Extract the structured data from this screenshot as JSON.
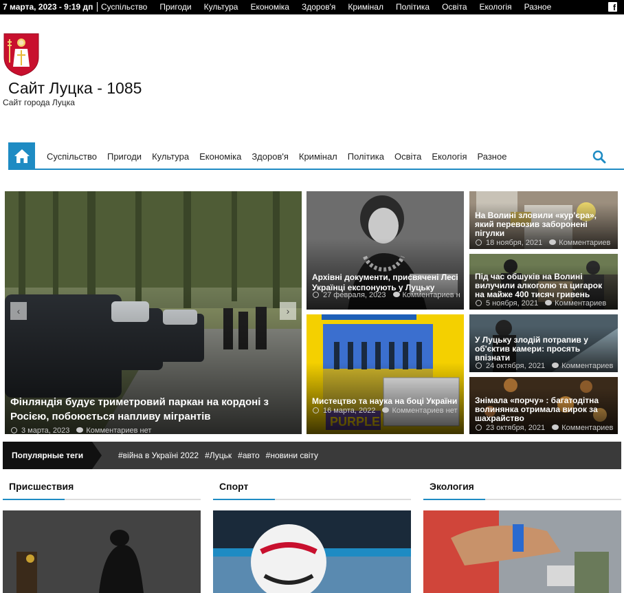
{
  "topbar": {
    "date": "7 марта, 2023 - 9:19 дп",
    "nav": [
      "Суспільство",
      "Пригоди",
      "Культура",
      "Економіка",
      "Здоров'я",
      "Кримінал",
      "Політика",
      "Освіта",
      "Екологія",
      "Разное"
    ],
    "social_icon": "facebook-icon"
  },
  "header": {
    "title": "Сайт Луцка - 1085",
    "tagline": "Сайт города Луцка"
  },
  "mainnav": {
    "items": [
      "Суспільство",
      "Пригоди",
      "Культура",
      "Економіка",
      "Здоров'я",
      "Кримінал",
      "Політика",
      "Освіта",
      "Екологія",
      "Разное"
    ],
    "home_icon": "home-icon",
    "search_icon": "search-icon"
  },
  "featured": {
    "big": {
      "title": "Фінляндія будує триметровий паркан на кордоні з Росією, побоюється напливу мігрантів",
      "date": "3 марта, 2023",
      "comments": "Комментариев нет"
    },
    "mid": [
      {
        "title": "Архівні документи, присвячені Лесі Українці експонують у Луцьку",
        "date": "27 февраля, 2023",
        "comments": "Комментариев нет"
      },
      {
        "title": "Мистецтво та наука на боці України",
        "date": "16 марта, 2022",
        "comments": "Комментариев нет"
      }
    ],
    "small": [
      {
        "title": "На Волині зловили «кур'єра», який перевозив заборонені пігулки",
        "date": "18 ноября, 2021",
        "comments": "Комментариев"
      },
      {
        "title": "Під час обшуків на Волині вилучили алкоголю та цигарок на майже 400 тисяч гривень",
        "date": "5 ноября, 2021",
        "comments": "Комментариев"
      },
      {
        "title": "У Луцьку злодій потрапив у об'єктив камери: просять впізнати",
        "date": "24 октября, 2021",
        "comments": "Комментариев"
      },
      {
        "title": "Знімала «порчу» : багатодітна волинянка отримала вирок за шахрайство",
        "date": "23 октября, 2021",
        "comments": "Комментариев"
      }
    ]
  },
  "tags": {
    "label": "Популярные теги",
    "items": [
      "#війна в Україні 2022",
      "#Луцьк",
      "#авто",
      "#новини світу"
    ]
  },
  "sections": [
    "Присшествия",
    "Спорт",
    "Экология"
  ]
}
